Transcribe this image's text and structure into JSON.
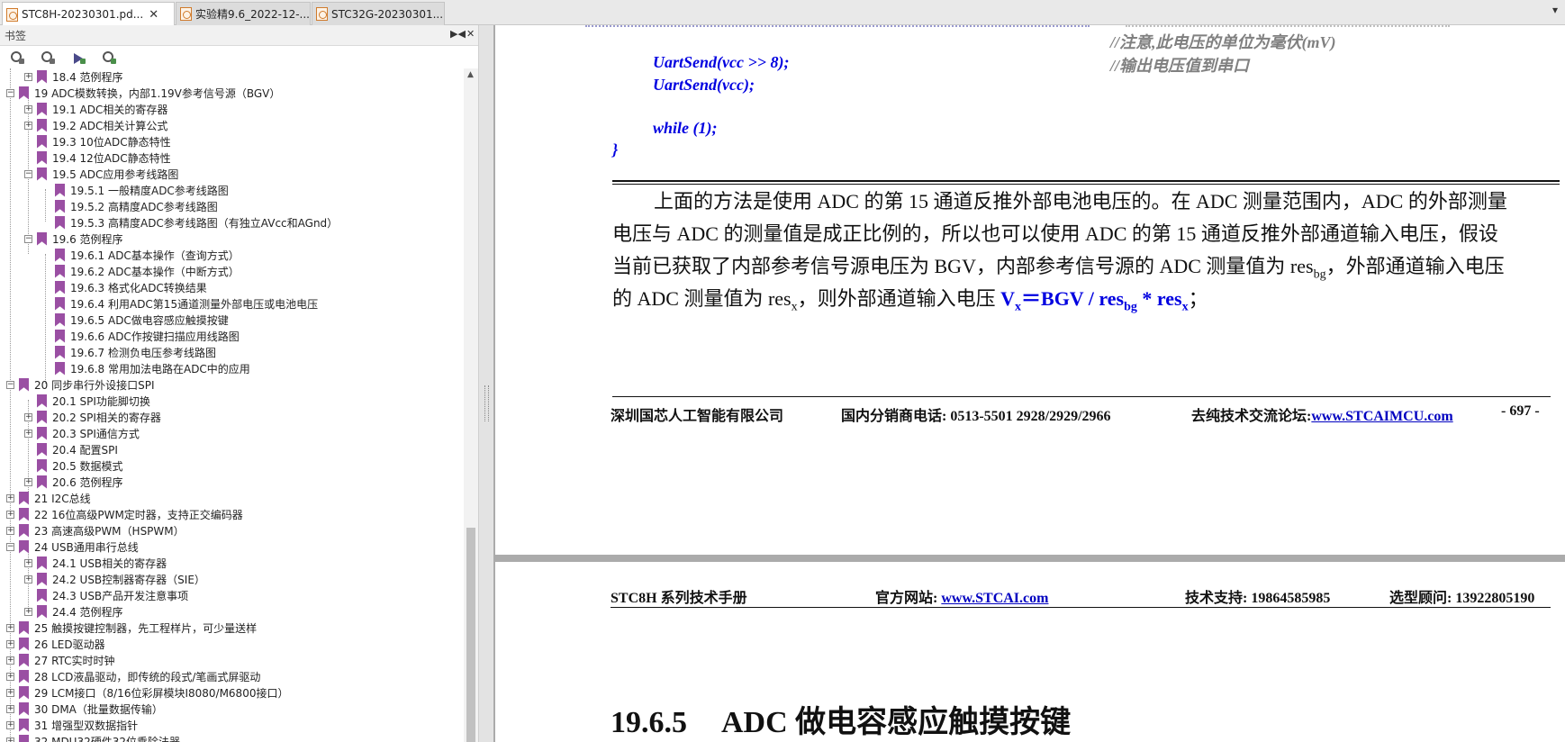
{
  "tabs": [
    {
      "label": "STC8H-20230301.pd...",
      "close": "✕"
    },
    {
      "label": "实验精9.6_2022-12-..."
    },
    {
      "label": "STC32G-20230301...."
    }
  ],
  "tab_menu_icon": "▾",
  "sidebar": {
    "title": "书签",
    "collapse_icon": "▶◀",
    "close_icon": "✕",
    "tools": [
      "bookmark-expand-icon",
      "bookmark-collapse-icon",
      "bookmark-goto-icon",
      "bookmark-find-icon"
    ],
    "items": [
      {
        "label": "18.4 范例程序"
      },
      {
        "label": "19 ADC模数转换，内部1.19V参考信号源（BGV）"
      },
      {
        "label": "19.1 ADC相关的寄存器"
      },
      {
        "label": "19.2 ADC相关计算公式"
      },
      {
        "label": "19.3 10位ADC静态特性"
      },
      {
        "label": "19.4 12位ADC静态特性"
      },
      {
        "label": "19.5 ADC应用参考线路图"
      },
      {
        "label": "19.5.1 一般精度ADC参考线路图"
      },
      {
        "label": "19.5.2 高精度ADC参考线路图"
      },
      {
        "label": "19.5.3 高精度ADC参考线路图（有独立AVcc和AGnd）"
      },
      {
        "label": "19.6 范例程序"
      },
      {
        "label": "19.6.1 ADC基本操作（查询方式）"
      },
      {
        "label": "19.6.2 ADC基本操作（中断方式）"
      },
      {
        "label": "19.6.3 格式化ADC转换结果"
      },
      {
        "label": "19.6.4 利用ADC第15通道测量外部电压或电池电压"
      },
      {
        "label": "19.6.5 ADC做电容感应触摸按键"
      },
      {
        "label": "19.6.6 ADC作按键扫描应用线路图"
      },
      {
        "label": "19.6.7 检测负电压参考线路图"
      },
      {
        "label": "19.6.8 常用加法电路在ADC中的应用"
      },
      {
        "label": "20 同步串行外设接口SPI"
      },
      {
        "label": "20.1 SPI功能脚切换"
      },
      {
        "label": "20.2 SPI相关的寄存器"
      },
      {
        "label": "20.3 SPI通信方式"
      },
      {
        "label": "20.4 配置SPI"
      },
      {
        "label": "20.5 数据模式"
      },
      {
        "label": "20.6 范例程序"
      },
      {
        "label": "21 I2C总线"
      },
      {
        "label": "22 16位高级PWM定时器，支持正交编码器"
      },
      {
        "label": "23 高速高级PWM（HSPWM）"
      },
      {
        "label": "24 USB通用串行总线"
      },
      {
        "label": "24.1 USB相关的寄存器"
      },
      {
        "label": "24.2 USB控制器寄存器（SIE）"
      },
      {
        "label": "24.3 USB产品开发注意事项"
      },
      {
        "label": "24.4 范例程序"
      },
      {
        "label": "25 触摸按键控制器，先工程样片，可少量送样"
      },
      {
        "label": "26 LED驱动器"
      },
      {
        "label": "27 RTC实时时钟"
      },
      {
        "label": "28 LCD液晶驱动，即传统的段式/笔画式屏驱动"
      },
      {
        "label": "29 LCM接口（8/16位彩屏模块I8080/M6800接口）"
      },
      {
        "label": "30 DMA（批量数据传输）"
      },
      {
        "label": "31 增强型双数据指针"
      },
      {
        "label": "32 MDU32硬件32位乘除法器"
      }
    ]
  },
  "page1": {
    "code": [
      "UartSend(vcc >> 8);",
      "UartSend(vcc);",
      "while (1);",
      "}"
    ],
    "comments": [
      "//注意,此电压的单位为毫伏(mV)",
      "//输出电压值到串口"
    ],
    "paragraph": {
      "line1": "上面的方法是使用 ADC 的第 15 通道反推外部电池电压的。在 ADC 测量范围内，ADC 的外部测量",
      "line2": "电压与 ADC 的测量值是成正比例的，所以也可以使用 ADC 的第 15 通道反推外部通道输入电压，假设",
      "line3_a": "当前已获取了内部参考信号源电压为 BGV，内部参考信号源的 ADC 测量值为 res",
      "line3_sub": "bg",
      "line3_b": "，外部通道输入电压",
      "line4_a": "的 ADC 测量值为 res",
      "line4_sub": "x",
      "line4_b": "，则外部通道输入电压 ",
      "formula_v": "V",
      "formula_vsub": "x",
      "formula_mid": "＝BGV / res",
      "formula_bg": "bg",
      "formula_mul": " * res",
      "formula_x": "x",
      "formula_end": "；"
    },
    "footer": {
      "company": "深圳国芯人工智能有限公司",
      "phone": "国内分销商电话: 0513-5501 2928/2929/2966",
      "forum_label": "去纯技术交流论坛:",
      "forum_link": "www.STCAIMCU.com",
      "page_no": "- 697 -"
    }
  },
  "page2": {
    "header": {
      "manual": "STC8H 系列技术手册",
      "site_label": "官方网站: ",
      "site_link": "www.STCAI.com",
      "support": "技术支持: 19864585985",
      "advisor": "选型顾问: 13922805190"
    },
    "section_number": "19.6.5",
    "section_title": "ADC 做电容感应触摸按键"
  }
}
